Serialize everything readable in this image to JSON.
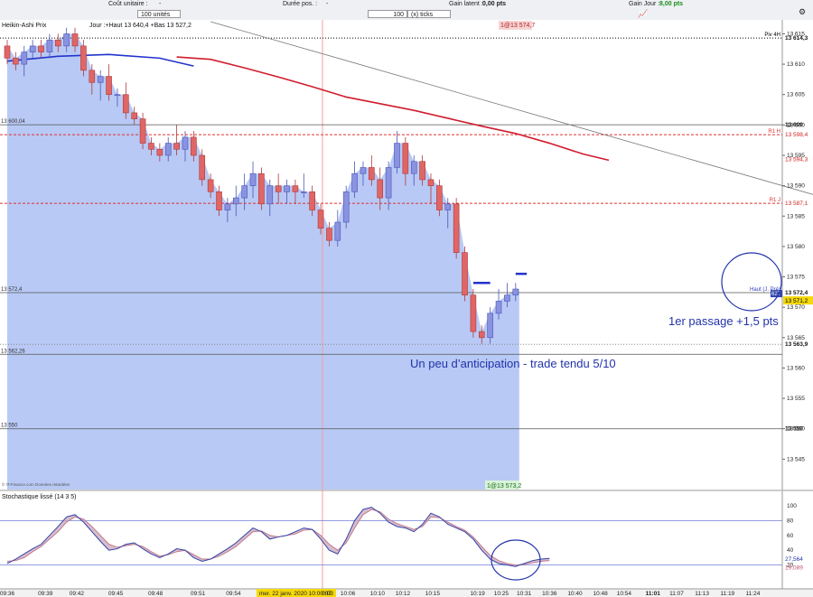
{
  "toolbar": {
    "cout_label": "Coût unitaire :",
    "cout_value": "-",
    "qty_value": "100 unités",
    "duree_label": "Durée pos. :",
    "duree_value": "-",
    "ticks_qty": "100",
    "ticks_unit": "(x) ticks",
    "gain_latent_label": "Gain latent :",
    "gain_latent_value": "0,00 pts",
    "gain_jour_label": "Gain Jour :",
    "gain_jour_value": "8,00 pts"
  },
  "chart_data": {
    "type": "candlestick",
    "header": {
      "title": "Heikin-Ashi Prix",
      "info": "Jour :+Haut 13 640,4 +Bas 13 527,2",
      "badge": "1@13 574,7",
      "source": "© IT-Finance.com Données retardées"
    },
    "y_axis": {
      "ylim": [
        13540,
        13617
      ],
      "ticks": [
        "13 615",
        "13 610",
        "13 605",
        "13 600",
        "13 595",
        "13 590",
        "13 585",
        "13 580",
        "13 575",
        "13 570",
        "13 565",
        "13 560",
        "13 555",
        "13 550",
        "13 545"
      ],
      "tick_values": [
        13615,
        13610,
        13605,
        13600,
        13595,
        13590,
        13585,
        13580,
        13575,
        13570,
        13565,
        13560,
        13555,
        13550,
        13545
      ]
    },
    "x_axis": {
      "ticks": [
        "09:36",
        "09:39",
        "09:42",
        "09:45",
        "09:48",
        "09:51",
        "09:54",
        "mer. 22 janv. 2020 10:00:07",
        "0:03",
        "10:06",
        "10:10",
        "10:12",
        "10:15",
        "10:19",
        "10:25",
        "10:31",
        "10:36",
        "10:40",
        "10:48",
        "10:54",
        "11:01",
        "11:07",
        "11:13",
        "11:19",
        "11:24"
      ],
      "tick_idx": [
        0,
        4.5,
        8.2,
        12.8,
        17.5,
        22.5,
        26.7,
        34,
        37.8,
        40.2,
        43.7,
        46.7,
        50.2,
        55.5,
        58.3,
        61,
        64,
        67,
        70,
        72.8,
        76.2,
        79,
        82,
        85,
        88
      ]
    },
    "candles": [
      {
        "o": 13613,
        "h": 13614,
        "l": 13610,
        "c": 13611
      },
      {
        "o": 13611,
        "h": 13612,
        "l": 13609,
        "c": 13610
      },
      {
        "o": 13610,
        "h": 13613,
        "l": 13608,
        "c": 13612
      },
      {
        "o": 13612,
        "h": 13614,
        "l": 13611,
        "c": 13613
      },
      {
        "o": 13613,
        "h": 13614,
        "l": 13611,
        "c": 13612
      },
      {
        "o": 13612,
        "h": 13615,
        "l": 13611,
        "c": 13614
      },
      {
        "o": 13614,
        "h": 13615,
        "l": 13612,
        "c": 13613
      },
      {
        "o": 13613,
        "h": 13616,
        "l": 13612,
        "c": 13615
      },
      {
        "o": 13615,
        "h": 13616,
        "l": 13612,
        "c": 13613
      },
      {
        "o": 13613,
        "h": 13614,
        "l": 13608,
        "c": 13609
      },
      {
        "o": 13609,
        "h": 13610,
        "l": 13605,
        "c": 13607
      },
      {
        "o": 13607,
        "h": 13609,
        "l": 13604,
        "c": 13608
      },
      {
        "o": 13608,
        "h": 13610,
        "l": 13604,
        "c": 13605
      },
      {
        "o": 13605,
        "h": 13606,
        "l": 13603,
        "c": 13605
      },
      {
        "o": 13605,
        "h": 13607,
        "l": 13601,
        "c": 13602
      },
      {
        "o": 13602,
        "h": 13603,
        "l": 13600,
        "c": 13601
      },
      {
        "o": 13601,
        "h": 13602,
        "l": 13596,
        "c": 13597
      },
      {
        "o": 13597,
        "h": 13598,
        "l": 13595,
        "c": 13596
      },
      {
        "o": 13596,
        "h": 13597,
        "l": 13594,
        "c": 13595
      },
      {
        "o": 13595,
        "h": 13598,
        "l": 13594,
        "c": 13597
      },
      {
        "o": 13597,
        "h": 13600,
        "l": 13595,
        "c": 13596
      },
      {
        "o": 13596,
        "h": 13599,
        "l": 13594,
        "c": 13598
      },
      {
        "o": 13598,
        "h": 13599,
        "l": 13594,
        "c": 13595
      },
      {
        "o": 13595,
        "h": 13596,
        "l": 13590,
        "c": 13591
      },
      {
        "o": 13591,
        "h": 13592,
        "l": 13588,
        "c": 13589
      },
      {
        "o": 13589,
        "h": 13590,
        "l": 13585,
        "c": 13586
      },
      {
        "o": 13586,
        "h": 13588,
        "l": 13584,
        "c": 13587
      },
      {
        "o": 13587,
        "h": 13590,
        "l": 13585,
        "c": 13588
      },
      {
        "o": 13588,
        "h": 13592,
        "l": 13586,
        "c": 13590
      },
      {
        "o": 13590,
        "h": 13594,
        "l": 13588,
        "c": 13592
      },
      {
        "o": 13592,
        "h": 13593,
        "l": 13586,
        "c": 13587
      },
      {
        "o": 13587,
        "h": 13591,
        "l": 13585,
        "c": 13590
      },
      {
        "o": 13590,
        "h": 13592,
        "l": 13587,
        "c": 13589
      },
      {
        "o": 13589,
        "h": 13591,
        "l": 13587,
        "c": 13590
      },
      {
        "o": 13590,
        "h": 13591,
        "l": 13587,
        "c": 13589
      },
      {
        "o": 13589,
        "h": 13592,
        "l": 13588,
        "c": 13589
      },
      {
        "o": 13589,
        "h": 13590,
        "l": 13585,
        "c": 13586
      },
      {
        "o": 13586,
        "h": 13587,
        "l": 13582,
        "c": 13583
      },
      {
        "o": 13583,
        "h": 13584,
        "l": 13580,
        "c": 13581
      },
      {
        "o": 13581,
        "h": 13586,
        "l": 13580,
        "c": 13584
      },
      {
        "o": 13584,
        "h": 13590,
        "l": 13583,
        "c": 13589
      },
      {
        "o": 13589,
        "h": 13594,
        "l": 13588,
        "c": 13592
      },
      {
        "o": 13592,
        "h": 13594,
        "l": 13590,
        "c": 13593
      },
      {
        "o": 13593,
        "h": 13595,
        "l": 13590,
        "c": 13591
      },
      {
        "o": 13591,
        "h": 13593,
        "l": 13586,
        "c": 13588
      },
      {
        "o": 13588,
        "h": 13594,
        "l": 13586,
        "c": 13593
      },
      {
        "o": 13593,
        "h": 13599,
        "l": 13592,
        "c": 13597
      },
      {
        "o": 13597,
        "h": 13598,
        "l": 13590,
        "c": 13592
      },
      {
        "o": 13592,
        "h": 13595,
        "l": 13590,
        "c": 13594
      },
      {
        "o": 13594,
        "h": 13595,
        "l": 13590,
        "c": 13591
      },
      {
        "o": 13591,
        "h": 13592,
        "l": 13587,
        "c": 13590
      },
      {
        "o": 13590,
        "h": 13591,
        "l": 13585,
        "c": 13586
      },
      {
        "o": 13586,
        "h": 13588,
        "l": 13583,
        "c": 13587
      },
      {
        "o": 13587,
        "h": 13588,
        "l": 13578,
        "c": 13579
      },
      {
        "o": 13579,
        "h": 13580,
        "l": 13571,
        "c": 13572
      },
      {
        "o": 13572,
        "h": 13573,
        "l": 13565,
        "c": 13566
      },
      {
        "o": 13566,
        "h": 13567,
        "l": 13564,
        "c": 13565
      },
      {
        "o": 13565,
        "h": 13570,
        "l": 13564,
        "c": 13569
      },
      {
        "o": 13569,
        "h": 13573,
        "l": 13568,
        "c": 13571
      },
      {
        "o": 13571,
        "h": 13574,
        "l": 13570,
        "c": 13572
      },
      {
        "o": 13572,
        "h": 13574,
        "l": 13571,
        "c": 13573
      }
    ],
    "ma_blue": [
      [
        0,
        13610.5
      ],
      [
        6,
        13611.3
      ],
      [
        12,
        13611.6
      ],
      [
        18,
        13611
      ],
      [
        22,
        13609.7
      ]
    ],
    "ma_red": [
      [
        20,
        13611.2
      ],
      [
        24,
        13610.8
      ],
      [
        28,
        13609.4
      ],
      [
        32,
        13607.9
      ],
      [
        36,
        13606.3
      ],
      [
        40,
        13604.6
      ],
      [
        44,
        13603.5
      ],
      [
        48,
        13602.4
      ],
      [
        52,
        13601.1
      ],
      [
        56,
        13599.8
      ],
      [
        60,
        13598.6
      ],
      [
        64,
        13597
      ],
      [
        68,
        13595.2
      ],
      [
        71,
        13594.2
      ]
    ],
    "trendline": [
      [
        24,
        13617
      ],
      [
        106.5,
        13584
      ]
    ],
    "levels": [
      {
        "value": 13614.3,
        "style": "dotted",
        "color": "#000000",
        "left_label": "",
        "right_label": "Piv 4H",
        "axis_label": "13 614,3"
      },
      {
        "value": 13600.04,
        "style": "solid",
        "color": "#555555",
        "left_label": "13 600,04",
        "right_label": "",
        "axis_label": "13 600"
      },
      {
        "value": 13598.4,
        "style": "dashed",
        "color": "#e03030",
        "left_label": "",
        "right_label": "R1 H",
        "axis_label": "13 598,4"
      },
      {
        "value": 13594.3,
        "style": "none",
        "color": "#e03030",
        "left_label": "",
        "right_label": "",
        "axis_label": "13 594,3"
      },
      {
        "value": 13587.1,
        "style": "dashed",
        "color": "#e03030",
        "left_label": "",
        "right_label": "R1 J",
        "axis_label": "13 587,1"
      },
      {
        "value": 13572.4,
        "style": "solid",
        "color": "#555555",
        "left_label": "13 572,4",
        "right_label": "Haut (J. Pré)",
        "axis_label": "13 572,4"
      },
      {
        "value": 13563.9,
        "style": "dotted",
        "color": "#888888",
        "left_label": "",
        "right_label": "",
        "axis_label": "13 563,9"
      },
      {
        "value": 13562.26,
        "style": "solid",
        "color": "#555555",
        "left_label": "13 562,26",
        "right_label": "",
        "axis_label": ""
      },
      {
        "value": 13550,
        "style": "solid",
        "color": "#555555",
        "left_label": "13 550",
        "right_label": "",
        "axis_label": "13 550"
      }
    ],
    "price_tags": {
      "last": "13 571,2",
      "qty": "62T",
      "bottom_badge": "1@13 573,2"
    },
    "annotations": [
      {
        "text": "1er passage +1,5 pts",
        "color": "#2233aa"
      },
      {
        "text": "Un peu d’anticipation - trade tendu 5/10",
        "color": "#2233aa"
      }
    ],
    "stochastic": {
      "title": "Stochastique lissé (14 3 5)",
      "ylim": [
        0,
        100
      ],
      "ticks": [
        "100",
        "80",
        "60",
        "40",
        "20"
      ],
      "tick_values": [
        100,
        80,
        60,
        40,
        20
      ],
      "value_labels": [
        "27,564",
        "19,089"
      ],
      "k": [
        22,
        28,
        35,
        42,
        48,
        60,
        72,
        85,
        88,
        78,
        65,
        52,
        40,
        42,
        48,
        50,
        42,
        35,
        30,
        35,
        42,
        40,
        30,
        25,
        28,
        35,
        42,
        50,
        60,
        70,
        65,
        55,
        58,
        60,
        65,
        70,
        68,
        55,
        40,
        35,
        55,
        80,
        95,
        98,
        90,
        78,
        72,
        70,
        65,
        75,
        90,
        85,
        75,
        70,
        65,
        55,
        40,
        28,
        22,
        20,
        18,
        22,
        26,
        28,
        29
      ],
      "d": [
        25,
        26,
        30,
        38,
        45,
        55,
        65,
        78,
        85,
        82,
        72,
        60,
        48,
        44,
        46,
        48,
        45,
        38,
        32,
        34,
        38,
        40,
        34,
        28,
        28,
        32,
        38,
        45,
        55,
        65,
        66,
        60,
        58,
        60,
        62,
        67,
        68,
        60,
        48,
        40,
        50,
        70,
        88,
        95,
        92,
        82,
        76,
        72,
        68,
        72,
        85,
        84,
        78,
        72,
        67,
        58,
        45,
        33,
        26,
        22,
        20,
        21,
        23,
        25,
        26
      ]
    }
  }
}
